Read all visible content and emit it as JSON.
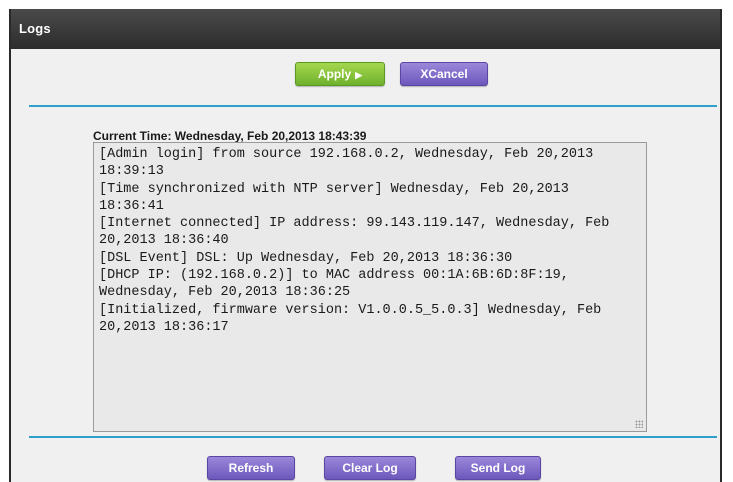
{
  "header": {
    "title": "Logs"
  },
  "toolbar": {
    "apply_label": "Apply",
    "apply_icon": "▶",
    "cancel_icon": "X",
    "cancel_label": "Cancel"
  },
  "current_time": "Current Time: Wednesday, Feb 20,2013 18:43:39",
  "log": [
    "[Admin login] from source 192.168.0.2, Wednesday, Feb 20,2013 18:39:13",
    "[Time synchronized with NTP server] Wednesday, Feb 20,2013 18:36:41",
    "[Internet connected] IP address: 99.143.119.147, Wednesday, Feb 20,2013 18:36:40",
    "[DSL Event] DSL: Up Wednesday, Feb 20,2013 18:36:30",
    "[DHCP IP: (192.168.0.2)] to MAC address 00:1A:6B:6D:8F:19, Wednesday, Feb 20,2013 18:36:25",
    "[Initialized, firmware version: V1.0.0.5_5.0.3] Wednesday, Feb 20,2013 18:36:17"
  ],
  "footer": {
    "refresh_label": "Refresh",
    "clear_label": "Clear Log",
    "send_label": "Send Log"
  },
  "colors": {
    "apply": "#7cbf33",
    "action": "#7a66c8",
    "rule": "#2f9fc7",
    "titlebar": "#333333"
  }
}
